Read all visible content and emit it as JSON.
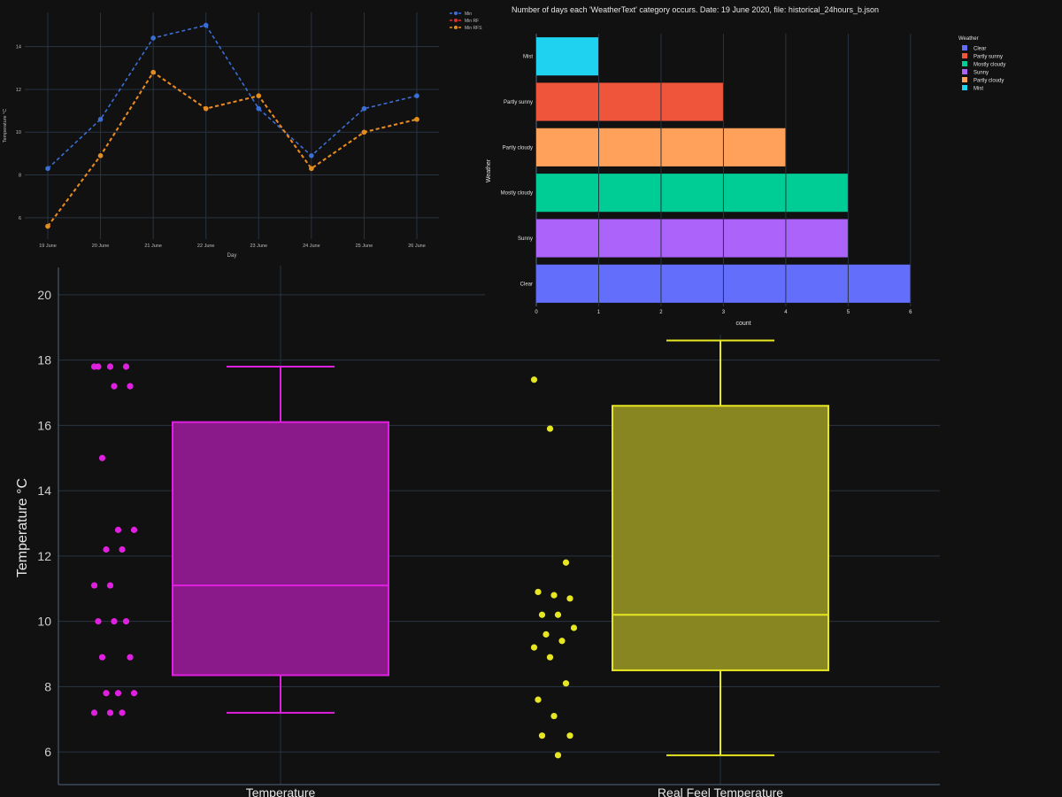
{
  "chart_data": [
    {
      "id": "box",
      "type": "box",
      "ylabel": "Temperature °C",
      "ylim": [
        5,
        21
      ],
      "yticks": [
        6,
        8,
        10,
        12,
        14,
        16,
        18,
        20
      ],
      "grid": true,
      "series": [
        {
          "category": "Temperature",
          "color": "#e020e0",
          "fill": "#8a1a8a",
          "min": 7.2,
          "q1": 8.35,
          "median": 11.1,
          "q3": 16.1,
          "max": 17.8,
          "points": [
            17.8,
            17.8,
            17.8,
            17.8,
            17.2,
            17.2,
            15.0,
            12.8,
            12.8,
            12.2,
            12.2,
            11.1,
            11.1,
            10.0,
            10.0,
            10.0,
            8.9,
            8.9,
            7.8,
            7.8,
            7.8,
            7.2,
            7.2,
            7.2
          ]
        },
        {
          "category": "Real Feel Temperature",
          "color": "#e6e622",
          "fill": "#878620",
          "min": 5.9,
          "q1": 8.5,
          "median": 10.2,
          "q3": 16.6,
          "max": 18.6,
          "points": [
            17.4,
            15.9,
            11.8,
            10.9,
            10.8,
            10.7,
            10.2,
            10.2,
            9.8,
            9.6,
            9.4,
            9.2,
            8.9,
            8.1,
            7.6,
            7.1,
            6.5,
            6.5,
            5.9
          ]
        }
      ]
    },
    {
      "id": "line",
      "type": "line",
      "xlabel": "Day",
      "ylabel": "Temperature °C",
      "categories": [
        "19 June",
        "20 June",
        "21 June",
        "22 June",
        "23 June",
        "24 June",
        "25 June",
        "26 June"
      ],
      "ylim": [
        5,
        15.6
      ],
      "yticks": [
        6,
        8,
        10,
        12,
        14
      ],
      "legend_position": "top-right",
      "series": [
        {
          "name": "Min",
          "color": "#3a6fd6",
          "values": [
            8.3,
            10.6,
            14.4,
            15.0,
            11.1,
            8.9,
            11.1,
            11.7
          ]
        },
        {
          "name": "Min RF",
          "color": "#d6322e",
          "values": [
            5.6,
            8.9,
            12.8,
            11.1,
            11.7,
            8.3,
            10.0,
            10.6
          ]
        },
        {
          "name": "Min RFS",
          "color": "#e08e1e",
          "values": [
            5.6,
            8.9,
            12.8,
            11.1,
            11.7,
            8.3,
            10.0,
            10.6
          ]
        }
      ]
    },
    {
      "id": "bar",
      "type": "bar",
      "orientation": "horizontal",
      "title": "Number of days each 'WeatherText' category occurs. Date: 19 June 2020, file: historical_24hours_b.json",
      "xlabel": "count",
      "ylabel": "Weather",
      "xlim": [
        0,
        6.3
      ],
      "xticks": [
        0,
        1,
        2,
        3,
        4,
        5,
        6
      ],
      "legend_title": "Weather",
      "legend_position": "right",
      "bars": [
        {
          "category": "Mist",
          "value": 1,
          "color": "#1fd3f0"
        },
        {
          "category": "Partly sunny",
          "value": 3,
          "color": "#ef553b"
        },
        {
          "category": "Partly cloudy",
          "value": 4,
          "color": "#ffa15a"
        },
        {
          "category": "Mostly cloudy",
          "value": 5,
          "color": "#00cc96"
        },
        {
          "category": "Sunny",
          "value": 5,
          "color": "#ab63fa"
        },
        {
          "category": "Clear",
          "value": 6,
          "color": "#636efa"
        }
      ],
      "legend": [
        {
          "label": "Clear",
          "color": "#636efa"
        },
        {
          "label": "Partly sunny",
          "color": "#ef553b"
        },
        {
          "label": "Mostly cloudy",
          "color": "#00cc96"
        },
        {
          "label": "Sunny",
          "color": "#ab63fa"
        },
        {
          "label": "Partly cloudy",
          "color": "#ffa15a"
        },
        {
          "label": "Mist",
          "color": "#1fd3f0"
        }
      ]
    }
  ]
}
